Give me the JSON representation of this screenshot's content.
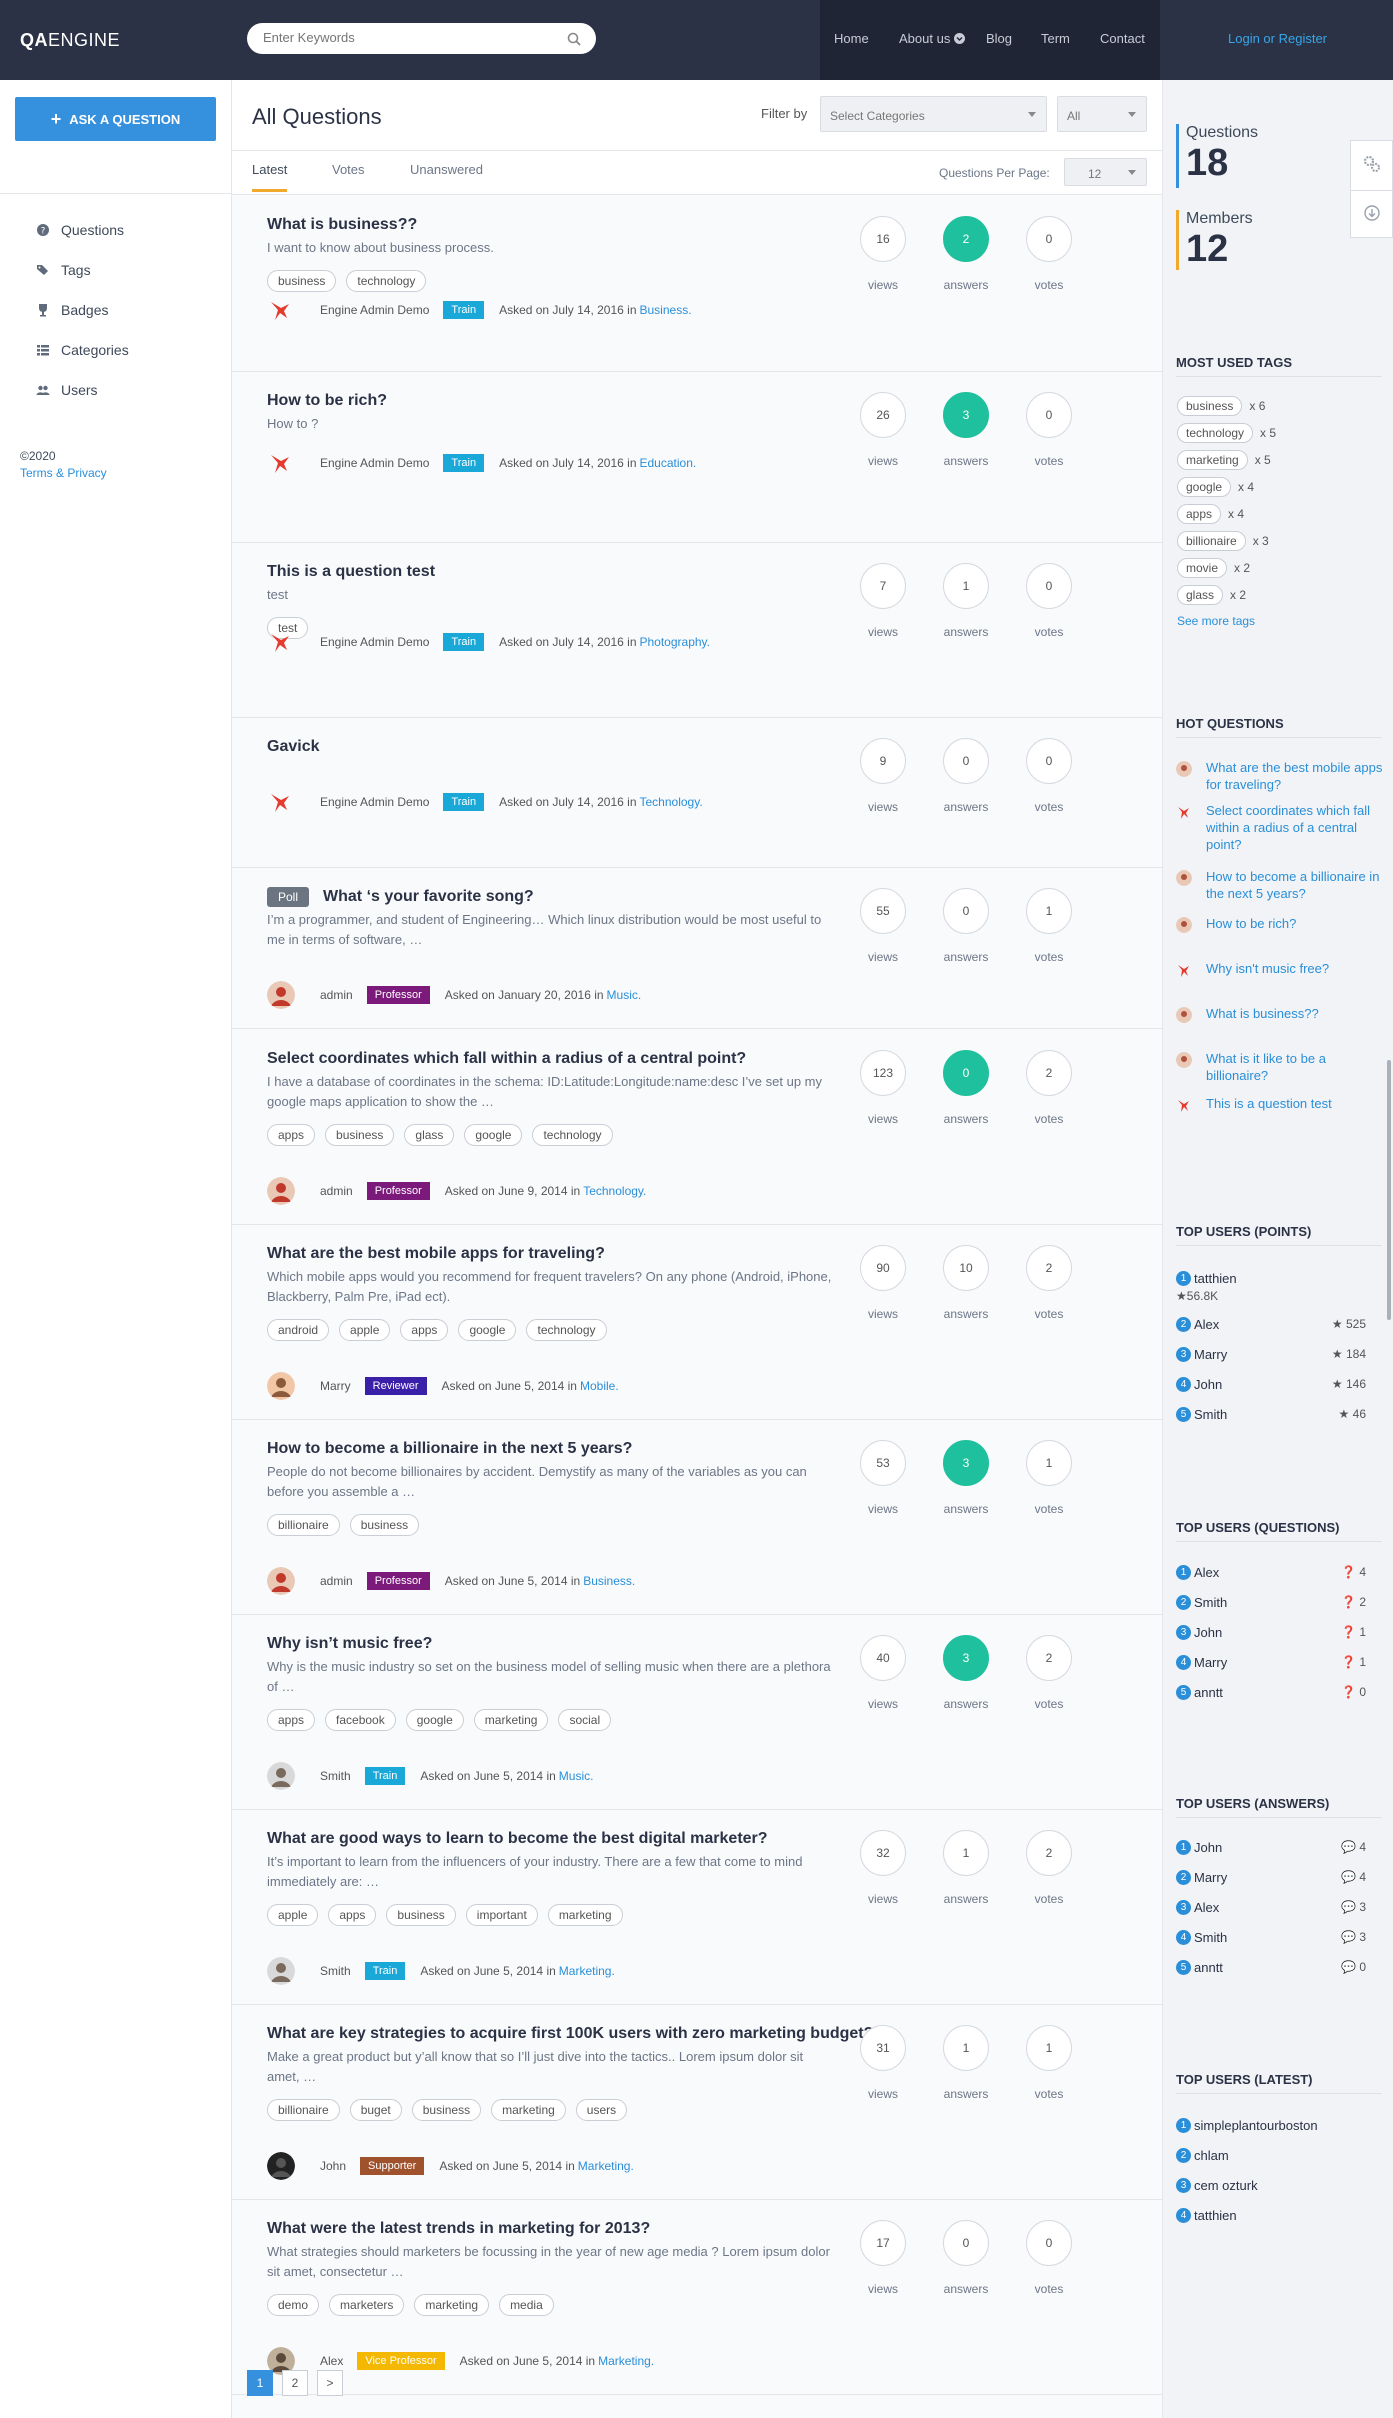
{
  "header": {
    "logo_bold": "QA",
    "logo_rest": "ENGINE",
    "search_placeholder": "Enter Keywords",
    "nav": [
      "Home",
      "About us",
      "Blog",
      "Term",
      "Contact"
    ],
    "login": "Login or Register"
  },
  "sidebar": {
    "ask": "ASK A QUESTION",
    "items": [
      "Questions",
      "Tags",
      "Badges",
      "Categories",
      "Users"
    ],
    "copyright": "©2020",
    "terms": "Terms & Privacy"
  },
  "main": {
    "title": "All Questions",
    "filter_label": "Filter by",
    "category_select": "Select Categories",
    "type_select": "All",
    "tabs": [
      "Latest",
      "Votes",
      "Unanswered"
    ],
    "per_page_label": "Questions Per Page:",
    "per_page": "12",
    "stat_labels": {
      "views": "views",
      "answers": "answers",
      "votes": "votes"
    },
    "questions": [
      {
        "title": "What is business??",
        "excerpt": "I want to know about business process.",
        "tags": [
          "business",
          "technology"
        ],
        "author": "Engine Admin Demo",
        "badge": "Train",
        "badge_color": "#1aa8d8",
        "asked": "Asked on July 14, 2016 in",
        "category": "Business.",
        "views": "16",
        "answers": "2",
        "votes": "0",
        "answered": true
      },
      {
        "title": "How to be rich?",
        "excerpt": "How to ?",
        "tags": [],
        "author": "Engine Admin Demo",
        "badge": "Train",
        "badge_color": "#1aa8d8",
        "asked": "Asked on July 14, 2016 in",
        "category": "Education.",
        "views": "26",
        "answers": "3",
        "votes": "0",
        "answered": true
      },
      {
        "title": "This is a question test",
        "excerpt": "test",
        "tags": [
          "test"
        ],
        "author": "Engine Admin Demo",
        "badge": "Train",
        "badge_color": "#1aa8d8",
        "asked": "Asked on July 14, 2016 in",
        "category": "Photography.",
        "views": "7",
        "answers": "1",
        "votes": "0",
        "answered": false
      },
      {
        "title": "Gavick",
        "excerpt": "",
        "tags": [],
        "author": "Engine Admin Demo",
        "badge": "Train",
        "badge_color": "#1aa8d8",
        "asked": "Asked on July 14, 2016 in",
        "category": "Technology.",
        "views": "9",
        "answers": "0",
        "votes": "0",
        "answered": false
      },
      {
        "poll": "Poll",
        "title": "What ‘s your favorite song?",
        "excerpt": "I’m a programmer, and student of Engineering… Which linux distribution would be most useful to me in terms of software, …",
        "tags": [],
        "author": "admin",
        "badge": "Professor",
        "badge_color": "#7b1a7b",
        "asked": "Asked on January 20, 2016 in",
        "category": "Music.",
        "views": "55",
        "answers": "0",
        "votes": "1",
        "answered": false
      },
      {
        "title": "Select coordinates which fall within a radius of a central point?",
        "excerpt": "I have a database of coordinates in the schema: ID:Latitude:Longitude:name:desc I’ve set up my google maps application to show the …",
        "tags": [
          "apps",
          "business",
          "glass",
          "google",
          "technology"
        ],
        "author": "admin",
        "badge": "Professor",
        "badge_color": "#7b1a7b",
        "asked": "Asked on June 9, 2014 in",
        "category": "Technology.",
        "views": "123",
        "answers": "0",
        "votes": "2",
        "answered": true
      },
      {
        "title": "What are the best mobile apps for traveling?",
        "excerpt": "Which mobile apps would you recommend for frequent travelers? On any phone (Android, iPhone, Blackberry, Palm Pre, iPad ect).",
        "tags": [
          "android",
          "apple",
          "apps",
          "google",
          "technology"
        ],
        "author": "Marry",
        "badge": "Reviewer",
        "badge_color": "#3a1fa8",
        "asked": "Asked on June 5, 2014 in",
        "category": "Mobile.",
        "views": "90",
        "answers": "10",
        "votes": "2",
        "answered": false
      },
      {
        "title": "How to become a billionaire in the next 5 years?",
        "excerpt": "People do not become billionaires by accident. Demystify as many of the variables as you can before you assemble a …",
        "tags": [
          "billionaire",
          "business"
        ],
        "author": "admin",
        "badge": "Professor",
        "badge_color": "#7b1a7b",
        "asked": "Asked on June 5, 2014 in",
        "category": "Business.",
        "views": "53",
        "answers": "3",
        "votes": "1",
        "answered": true
      },
      {
        "title": "Why isn’t music free?",
        "excerpt": "Why is the music industry so set on the business model of selling music when there are a plethora of …",
        "tags": [
          "apps",
          "facebook",
          "google",
          "marketing",
          "social"
        ],
        "author": "Smith",
        "badge": "Train",
        "badge_color": "#1aa8d8",
        "asked": "Asked on June 5, 2014 in",
        "category": "Music.",
        "views": "40",
        "answers": "3",
        "votes": "2",
        "answered": true
      },
      {
        "title": "What are good ways to learn to become the best digital marketer?",
        "excerpt": "It’s important to learn from the influencers of your industry. There are a few that come to mind immediately are: …",
        "tags": [
          "apple",
          "apps",
          "business",
          "important",
          "marketing"
        ],
        "author": "Smith",
        "badge": "Train",
        "badge_color": "#1aa8d8",
        "asked": "Asked on June 5, 2014 in",
        "category": "Marketing.",
        "views": "32",
        "answers": "1",
        "votes": "2",
        "answered": false
      },
      {
        "title": "What are key strategies to acquire first 100K users with zero marketing budget?",
        "excerpt": "Make a great product but y’all know that so I’ll just dive into the tactics.. Lorem ipsum dolor sit amet, …",
        "tags": [
          "billionaire",
          "buget",
          "business",
          "marketing",
          "users"
        ],
        "author": "John",
        "badge": "Supporter",
        "badge_color": "#a0522d",
        "asked": "Asked on June 5, 2014 in",
        "category": "Marketing.",
        "views": "31",
        "answers": "1",
        "votes": "1",
        "answered": false
      },
      {
        "title": "What were the latest trends in marketing for 2013?",
        "excerpt": "What strategies should marketers be focussing in the year of new age media ? Lorem ipsum dolor sit amet, consectetur …",
        "tags": [
          "demo",
          "marketers",
          "marketing",
          "media"
        ],
        "author": "Alex",
        "badge": "Vice Professor",
        "badge_color": "#f5b800",
        "asked": "Asked on June 5, 2014 in",
        "category": "Marketing.",
        "views": "17",
        "answers": "0",
        "votes": "0",
        "answered": false
      }
    ],
    "pages": [
      "1",
      "2",
      ">"
    ]
  },
  "right": {
    "questions_label": "Questions",
    "questions_count": "18",
    "members_label": "Members",
    "members_count": "12",
    "most_used_title": "MOST USED TAGS",
    "most_used": [
      {
        "tag": "business",
        "count": "x 6"
      },
      {
        "tag": "technology",
        "count": "x 5"
      },
      {
        "tag": "marketing",
        "count": "x 5"
      },
      {
        "tag": "google",
        "count": "x 4"
      },
      {
        "tag": "apps",
        "count": "x 4"
      },
      {
        "tag": "billionaire",
        "count": "x 3"
      },
      {
        "tag": "movie",
        "count": "x 2"
      },
      {
        "tag": "glass",
        "count": "x 2"
      }
    ],
    "see_more": "See more tags",
    "hot_title": "HOT QUESTIONS",
    "hot": [
      "What are the best mobile apps for traveling?",
      "Select coordinates which fall within a radius of a central point?",
      "How to become a billionaire in the next 5 years?",
      "How to be rich?",
      "Why isn't music free?",
      "What is business??",
      "What is it like to be a billionaire?",
      "This is a question test"
    ],
    "points_title": "TOP USERS (POINTS)",
    "points": [
      {
        "n": "1",
        "name": "tatthien",
        "v": "56.8K"
      },
      {
        "n": "2",
        "name": "Alex",
        "v": "525"
      },
      {
        "n": "3",
        "name": "Marry",
        "v": "184"
      },
      {
        "n": "4",
        "name": "John",
        "v": "146"
      },
      {
        "n": "5",
        "name": "Smith",
        "v": "46"
      }
    ],
    "questions_title": "TOP USERS (QUESTIONS)",
    "tq": [
      {
        "n": "1",
        "name": "Alex",
        "v": "4"
      },
      {
        "n": "2",
        "name": "Smith",
        "v": "2"
      },
      {
        "n": "3",
        "name": "John",
        "v": "1"
      },
      {
        "n": "4",
        "name": "Marry",
        "v": "1"
      },
      {
        "n": "5",
        "name": "anntt",
        "v": "0"
      }
    ],
    "answers_title": "TOP USERS (ANSWERS)",
    "ta": [
      {
        "n": "1",
        "name": "John",
        "v": "4"
      },
      {
        "n": "2",
        "name": "Marry",
        "v": "4"
      },
      {
        "n": "3",
        "name": "Alex",
        "v": "3"
      },
      {
        "n": "4",
        "name": "Smith",
        "v": "3"
      },
      {
        "n": "5",
        "name": "anntt",
        "v": "0"
      }
    ],
    "latest_title": "TOP USERS (LATEST)",
    "tl": [
      {
        "n": "1",
        "name": "simpleplantourboston"
      },
      {
        "n": "2",
        "name": "chlam"
      },
      {
        "n": "3",
        "name": "cem ozturk"
      },
      {
        "n": "4",
        "name": "tatthien"
      }
    ]
  }
}
